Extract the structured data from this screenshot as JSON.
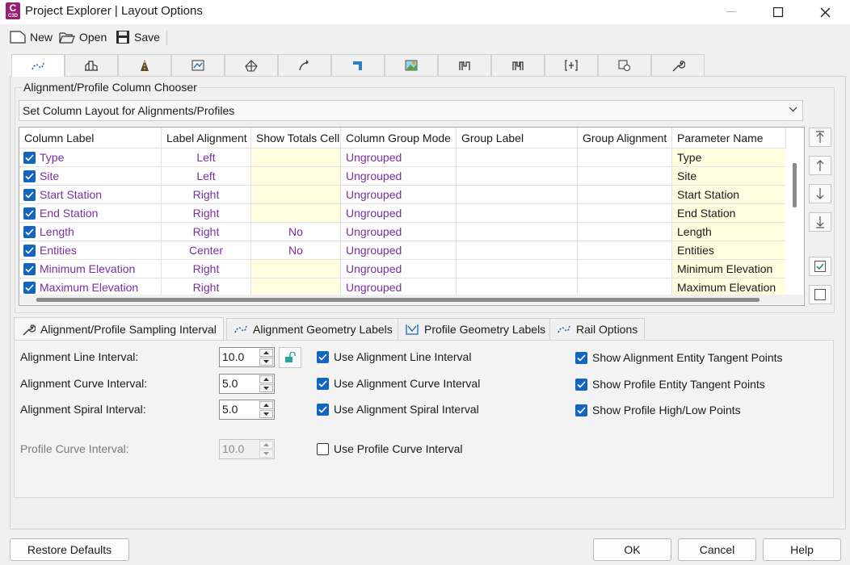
{
  "window": {
    "title": "Project Explorer | Layout Options",
    "app_icon_letter": "C",
    "app_icon_sub": "C3D"
  },
  "toolbar": {
    "new_label": "New",
    "open_label": "Open",
    "save_label": "Save"
  },
  "main_tabs": [
    {
      "icon": "alignment-tab-icon",
      "active": true
    },
    {
      "icon": "site-tab-icon"
    },
    {
      "icon": "corridor-tab-icon"
    },
    {
      "icon": "profile-view-tab-icon"
    },
    {
      "icon": "surface-tab-icon"
    },
    {
      "icon": "feature-line-tab-icon"
    },
    {
      "icon": "pipe-tab-icon"
    },
    {
      "icon": "sample-line-tab-icon"
    },
    {
      "icon": "assembly-tab-icon"
    },
    {
      "icon": "subassembly-tab-icon"
    },
    {
      "icon": "section-view-tab-icon"
    },
    {
      "icon": "point-group-tab-icon"
    },
    {
      "icon": "wrench-tab-icon"
    }
  ],
  "column_chooser": {
    "title": "Alignment/Profile Column Chooser",
    "layout_select": "Set Column Layout for Alignments/Profiles",
    "headers": [
      "Column Label",
      "Label Alignment",
      "Show Totals Cell",
      "Column Group Mode",
      "Group Label",
      "Group Alignment",
      "Parameter Name"
    ],
    "rows": [
      {
        "label": "Type",
        "align": "Left",
        "totals": "",
        "group_mode": "Ungrouped",
        "group_label": "",
        "group_align": "",
        "param": "Type",
        "checked": true
      },
      {
        "label": "Site",
        "align": "Left",
        "totals": "",
        "group_mode": "Ungrouped",
        "group_label": "",
        "group_align": "",
        "param": "Site",
        "checked": true
      },
      {
        "label": "Start Station",
        "align": "Right",
        "totals": "",
        "group_mode": "Ungrouped",
        "group_label": "",
        "group_align": "",
        "param": "Start Station",
        "checked": true
      },
      {
        "label": "End Station",
        "align": "Right",
        "totals": "",
        "group_mode": "Ungrouped",
        "group_label": "",
        "group_align": "",
        "param": "End Station",
        "checked": true
      },
      {
        "label": "Length",
        "align": "Right",
        "totals": "No",
        "group_mode": "Ungrouped",
        "group_label": "",
        "group_align": "",
        "param": "Length",
        "checked": true
      },
      {
        "label": "Entities",
        "align": "Center",
        "totals": "No",
        "group_mode": "Ungrouped",
        "group_label": "",
        "group_align": "",
        "param": "Entities",
        "checked": true
      },
      {
        "label": "Minimum Elevation",
        "align": "Right",
        "totals": "",
        "group_mode": "Ungrouped",
        "group_label": "",
        "group_align": "",
        "param": "Minimum Elevation",
        "checked": true
      },
      {
        "label": "Maximum Elevation",
        "align": "Right",
        "totals": "",
        "group_mode": "Ungrouped",
        "group_label": "",
        "group_align": "",
        "param": "Maximum Elevation",
        "checked": true
      }
    ],
    "side_buttons": [
      "move-to-top-icon",
      "move-up-icon",
      "move-down-icon",
      "move-to-bottom-icon",
      "check-all-icon",
      "uncheck-all-icon"
    ]
  },
  "sub_tabs": [
    {
      "label": "Alignment/Profile Sampling Interval",
      "icon": "wrench-icon",
      "active": true
    },
    {
      "label": "Alignment Geometry Labels",
      "icon": "alignment-icon"
    },
    {
      "label": "Profile Geometry Labels",
      "icon": "profile-icon"
    },
    {
      "label": "Rail Options",
      "icon": "rail-icon"
    }
  ],
  "sampling": {
    "line_interval": {
      "label": "Alignment Line Interval:",
      "value": "10.0"
    },
    "curve_interval": {
      "label": "Alignment Curve Interval:",
      "value": "5.0"
    },
    "spiral_interval": {
      "label": "Alignment Spiral Interval:",
      "value": "5.0"
    },
    "profile_curve_interval": {
      "label": "Profile Curve Interval:",
      "value": "10.0",
      "disabled": true
    },
    "use_line": {
      "label": "Use Alignment Line Interval",
      "checked": true
    },
    "use_curve": {
      "label": "Use Alignment Curve Interval",
      "checked": true
    },
    "use_spiral": {
      "label": "Use Alignment Spiral Interval",
      "checked": true
    },
    "use_profile_curve": {
      "label": "Use Profile Curve Interval",
      "checked": false
    },
    "show_alignment_tangent": {
      "label": "Show Alignment Entity Tangent Points",
      "checked": true
    },
    "show_profile_tangent": {
      "label": "Show Profile Entity Tangent Points",
      "checked": true
    },
    "show_high_low": {
      "label": "Show Profile High/Low Points",
      "checked": true
    }
  },
  "footer": {
    "restore_defaults": "Restore Defaults",
    "ok": "OK",
    "cancel": "Cancel",
    "help": "Help"
  },
  "colors": {
    "accent": "#1565c0",
    "value_text": "#7b2ea3",
    "param_cell_bg": "#ffffe0",
    "app_icon": "#9b1e74"
  }
}
